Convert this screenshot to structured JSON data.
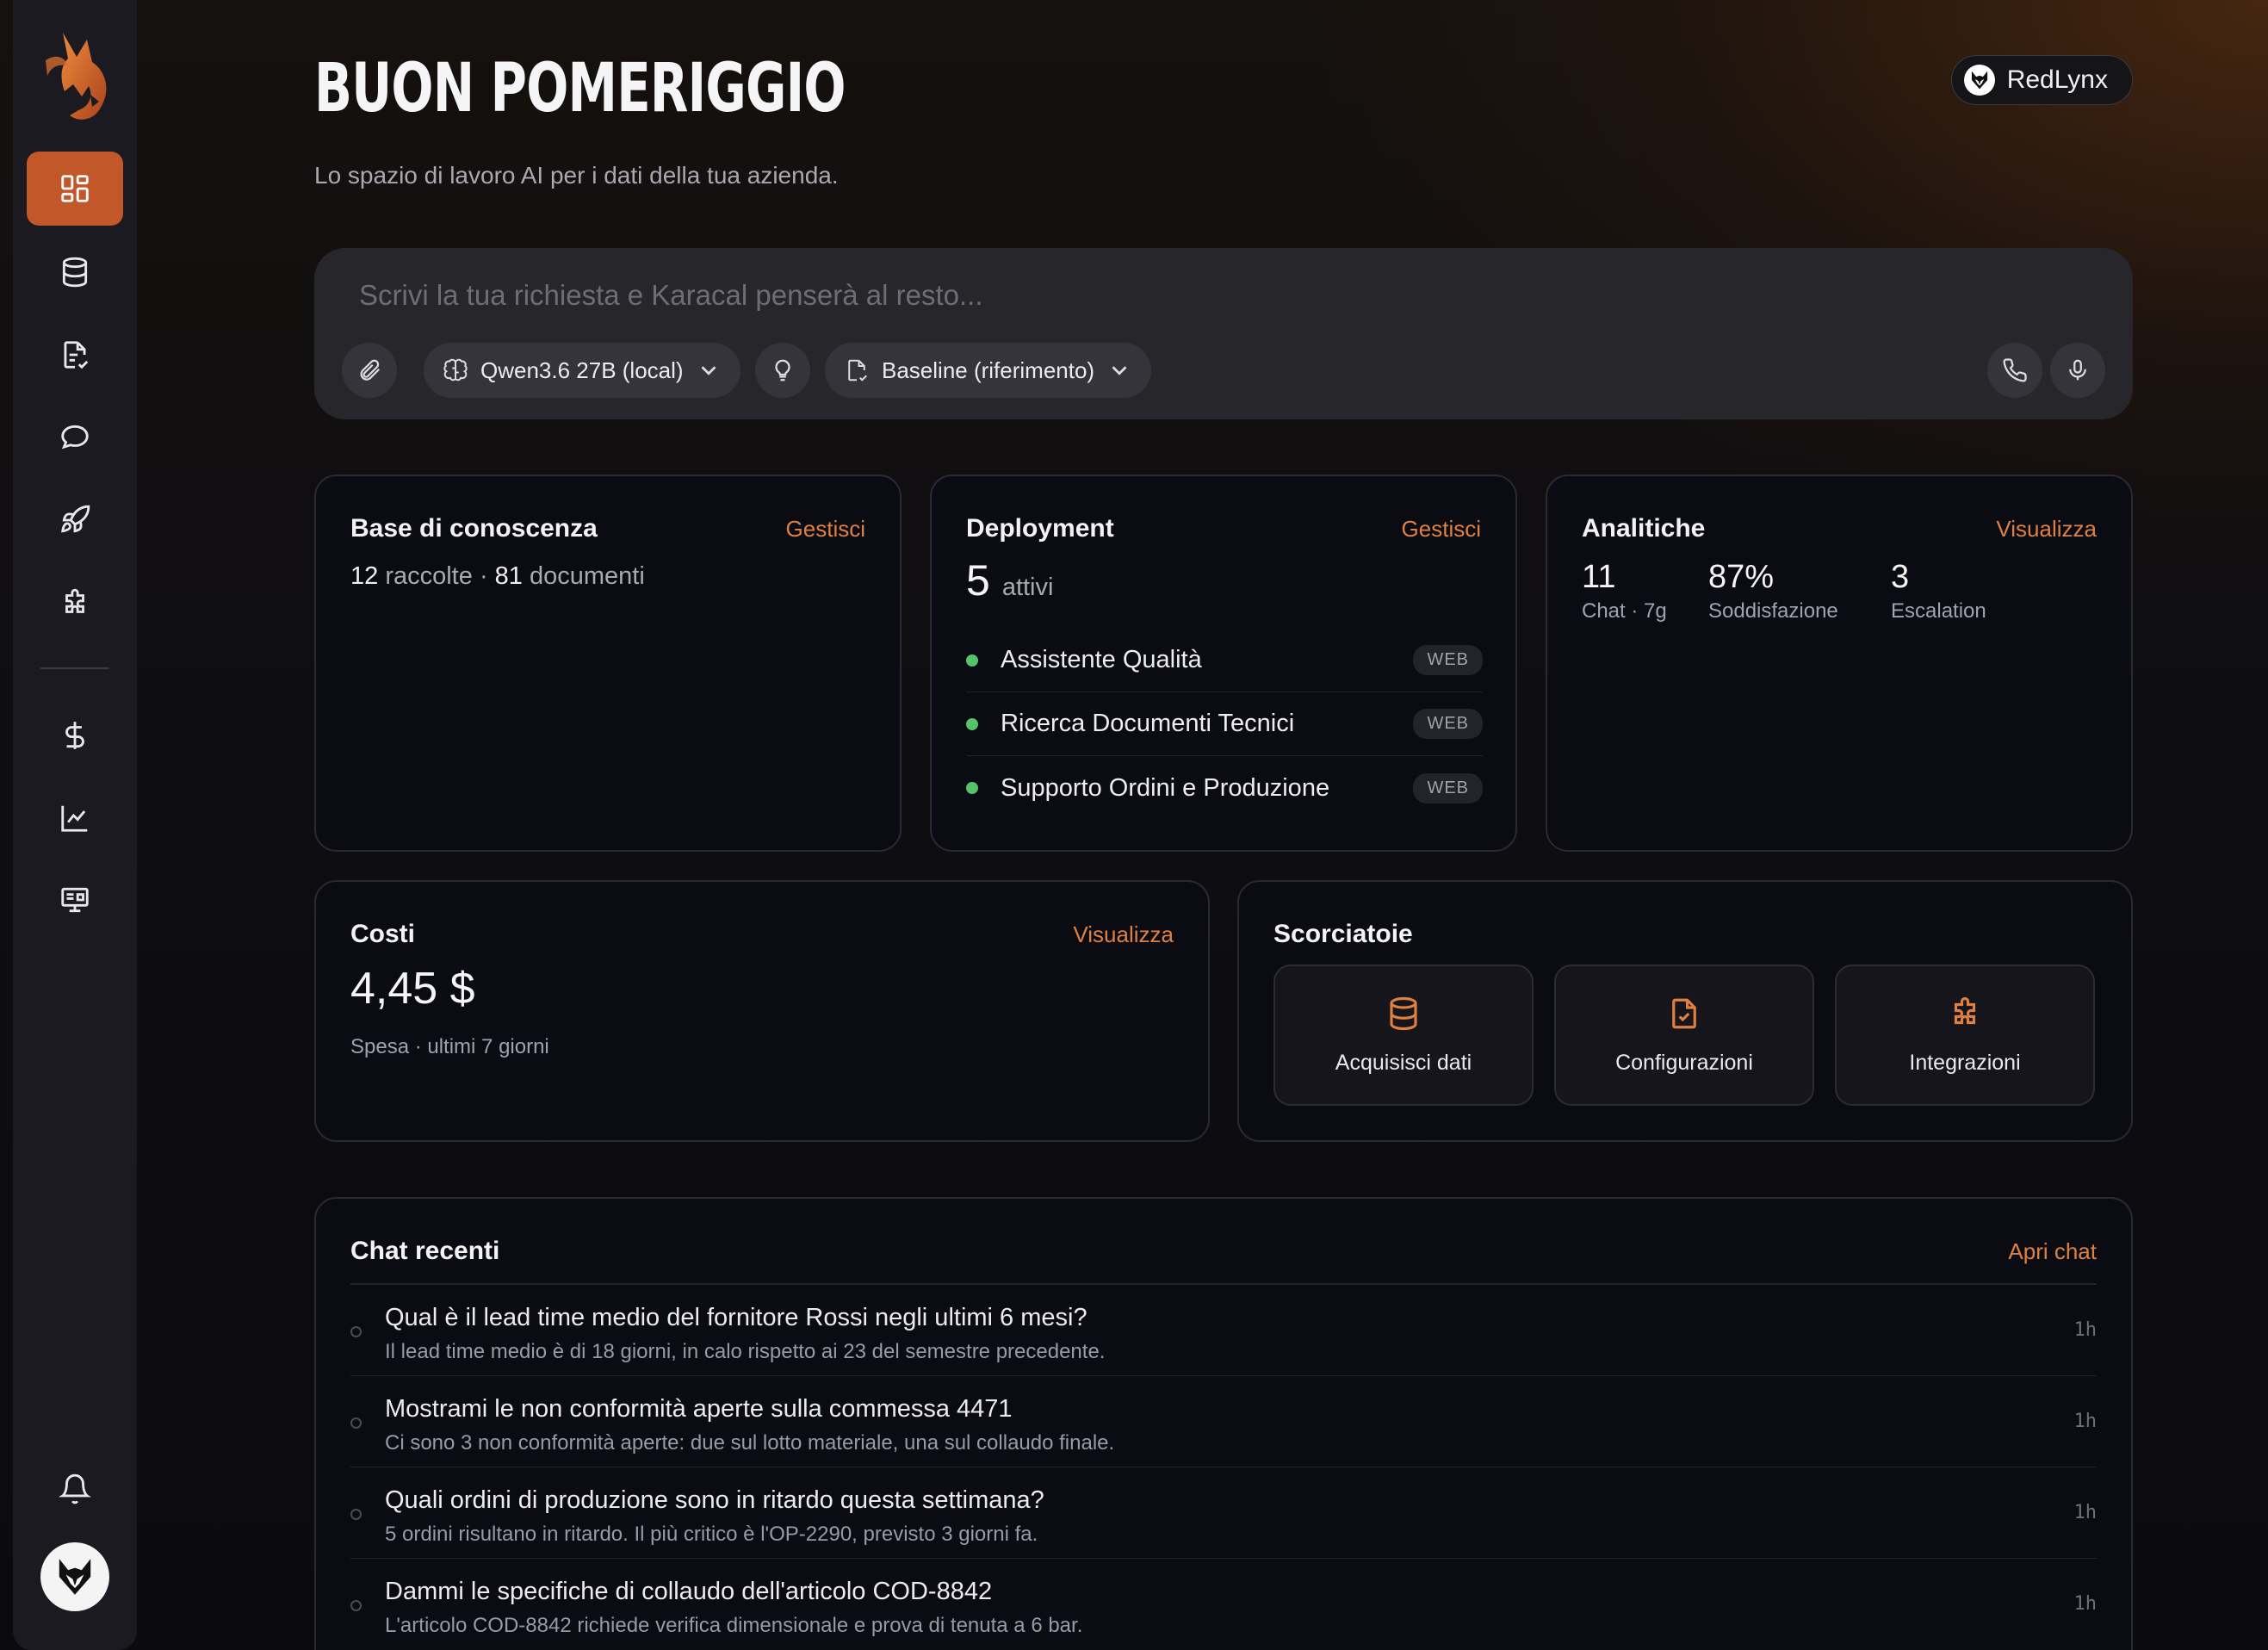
{
  "header": {
    "title": "BUON POMERIGGIO",
    "subtitle": "Lo spazio di lavoro AI per i dati della tua azienda.",
    "org_name": "RedLynx"
  },
  "sidebar": {
    "items": [
      {
        "icon": "dashboard-icon",
        "active": true
      },
      {
        "icon": "database-icon"
      },
      {
        "icon": "document-check-icon"
      },
      {
        "icon": "chat-bubble-icon"
      },
      {
        "icon": "rocket-icon"
      },
      {
        "icon": "puzzle-icon"
      },
      {
        "icon": "dollar-icon"
      },
      {
        "icon": "line-chart-icon"
      },
      {
        "icon": "monitor-icon"
      },
      {
        "icon": "bell-icon"
      }
    ]
  },
  "prompt": {
    "placeholder": "Scrivi la tua richiesta e Karacal penserà al resto...",
    "model": "Qwen3.6 27B (local)",
    "profile": "Baseline (riferimento)"
  },
  "knowledge": {
    "title": "Base di conoscenza",
    "link": "Gestisci",
    "collections": "12",
    "collections_label": "raccolte",
    "sep": "·",
    "documents": "81",
    "documents_label": "documenti"
  },
  "deployment": {
    "title": "Deployment",
    "link": "Gestisci",
    "count": "5",
    "count_label": "attivi",
    "items": [
      {
        "name": "Assistente Qualità",
        "tag": "WEB"
      },
      {
        "name": "Ricerca Documenti Tecnici",
        "tag": "WEB"
      },
      {
        "name": "Supporto Ordini e Produzione",
        "tag": "WEB"
      }
    ]
  },
  "analytics": {
    "title": "Analitiche",
    "link": "Visualizza",
    "stats": [
      {
        "value": "11",
        "label": "Chat · 7g"
      },
      {
        "value": "87%",
        "label": "Soddisfazione"
      },
      {
        "value": "3",
        "label": "Escalation"
      }
    ]
  },
  "costs": {
    "title": "Costi",
    "link": "Visualizza",
    "value": "4,45 $",
    "label": "Spesa · ultimi 7 giorni"
  },
  "shortcuts": {
    "title": "Scorciatoie",
    "items": [
      {
        "label": "Acquisisci dati",
        "icon": "database-icon"
      },
      {
        "label": "Configurazioni",
        "icon": "document-check-icon"
      },
      {
        "label": "Integrazioni",
        "icon": "puzzle-icon"
      }
    ]
  },
  "recent_chats": {
    "title": "Chat recenti",
    "link": "Apri chat",
    "items": [
      {
        "question": "Qual è il lead time medio del fornitore Rossi negli ultimi 6 mesi?",
        "answer": "Il lead time medio è di 18 giorni, in calo rispetto ai 23 del semestre precedente.",
        "time": "1h"
      },
      {
        "question": "Mostrami le non conformità aperte sulla commessa 4471",
        "answer": "Ci sono 3 non conformità aperte: due sul lotto materiale, una sul collaudo finale.",
        "time": "1h"
      },
      {
        "question": "Quali ordini di produzione sono in ritardo questa settimana?",
        "answer": "5 ordini risultano in ritardo. Il più critico è l'OP-2290, previsto 3 giorni fa.",
        "time": "1h"
      },
      {
        "question": "Dammi le specifiche di collaudo dell'articolo COD-8842",
        "answer": "L'articolo COD-8842 richiede verifica dimensionale e prova di tenuta a 6 bar.",
        "time": "1h"
      }
    ]
  },
  "colors": {
    "accent": "#c2572a",
    "link": "#e0803f",
    "status_ok": "#56c36b"
  }
}
